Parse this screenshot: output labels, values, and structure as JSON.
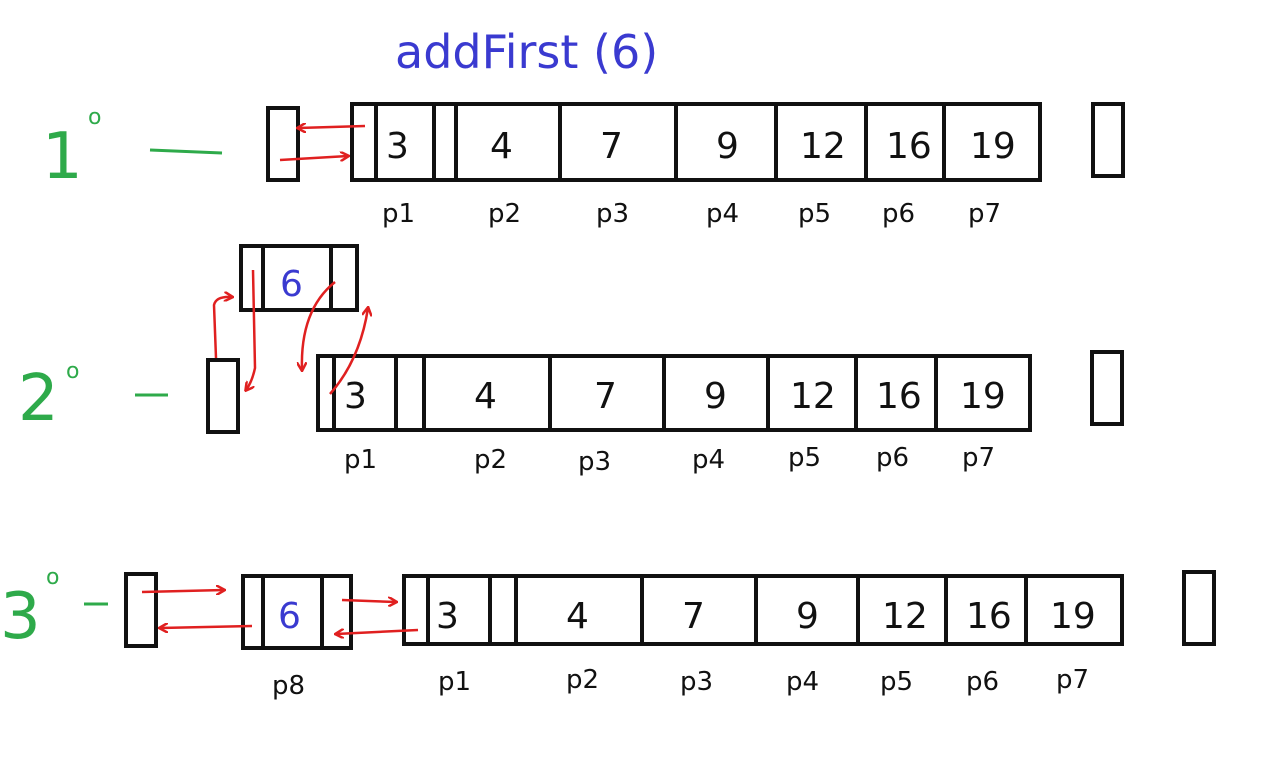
{
  "title": "addFirst (6)",
  "steps": [
    {
      "number": "1",
      "sup": "o"
    },
    {
      "number": "2",
      "sup": "o"
    },
    {
      "number": "3",
      "sup": "o"
    }
  ],
  "nodes": {
    "n3": {
      "value": "3",
      "label": "p1"
    },
    "n4": {
      "value": "4",
      "label": "p2"
    },
    "n7": {
      "value": "7",
      "label": "p3"
    },
    "n9": {
      "value": "9",
      "label": "p4"
    },
    "n12": {
      "value": "12",
      "label": "p5"
    },
    "n16": {
      "value": "16",
      "label": "p6"
    },
    "n19": {
      "value": "19",
      "label": "p7"
    },
    "n6": {
      "value": "6",
      "label": "p8"
    }
  },
  "colors": {
    "title": "#3a3ad0",
    "step": "#2eaa4a",
    "arrow": "#e02020",
    "box": "#111111"
  }
}
